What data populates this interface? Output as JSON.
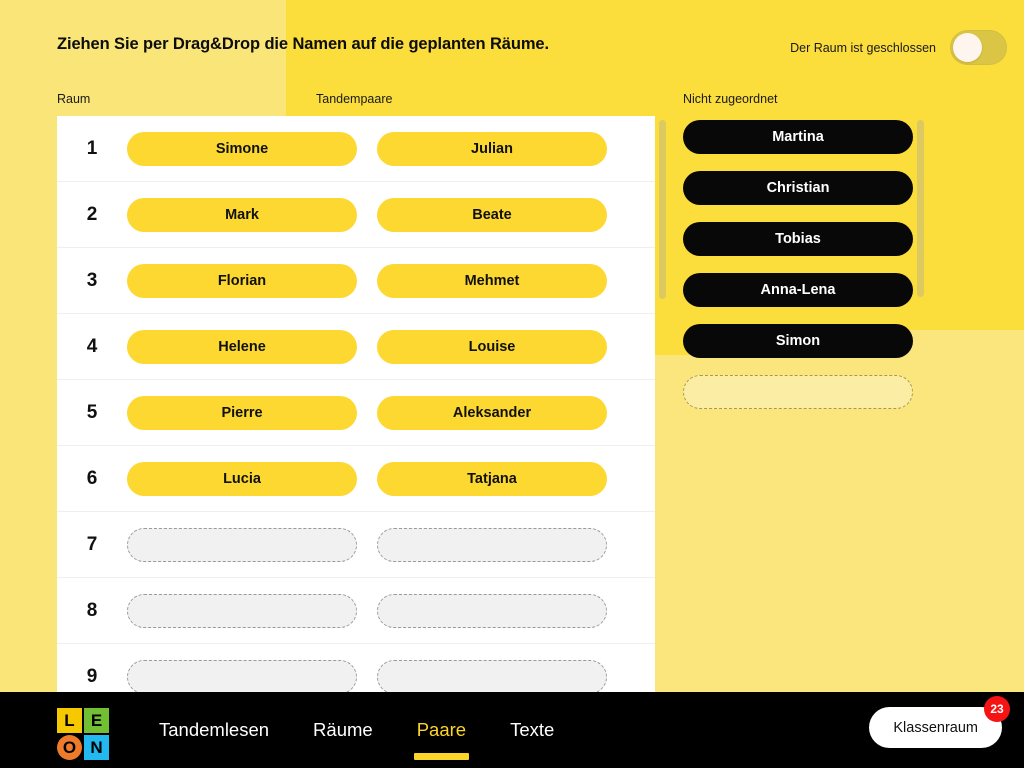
{
  "header": {
    "instruction": "Ziehen Sie per Drag&Drop die Namen auf die geplanten Räume.",
    "toggle_label": "Der Raum ist geschlossen",
    "toggle_state": "off"
  },
  "columns": {
    "room_label": "Raum",
    "pairs_label": "Tandempaare",
    "unassigned_label": "Nicht zugeordnet"
  },
  "rooms": [
    {
      "number": "1",
      "left": "Simone",
      "right": "Julian"
    },
    {
      "number": "2",
      "left": "Mark",
      "right": "Beate"
    },
    {
      "number": "3",
      "left": "Florian",
      "right": "Mehmet"
    },
    {
      "number": "4",
      "left": "Helene",
      "right": "Louise"
    },
    {
      "number": "5",
      "left": "Pierre",
      "right": "Aleksander"
    },
    {
      "number": "6",
      "left": "Lucia",
      "right": "Tatjana"
    },
    {
      "number": "7",
      "left": "",
      "right": ""
    },
    {
      "number": "8",
      "left": "",
      "right": ""
    },
    {
      "number": "9",
      "left": "",
      "right": ""
    }
  ],
  "unassigned": [
    "Martina",
    "Christian",
    "Tobias",
    "Anna-Lena",
    "Simon"
  ],
  "logo": {
    "l": "L",
    "e": "E",
    "o": "O",
    "n": "N"
  },
  "nav": {
    "items": [
      {
        "label": "Tandemlesen",
        "active": false
      },
      {
        "label": "Räume",
        "active": false
      },
      {
        "label": "Paare",
        "active": true
      },
      {
        "label": "Texte",
        "active": false
      }
    ]
  },
  "classroom": {
    "label": "Klassenraum",
    "badge": "23"
  },
  "colors": {
    "brand_yellow": "#FBDD3C",
    "pale_yellow": "#FAE578",
    "pill_yellow": "#FCD831",
    "black": "#080808",
    "badge_red": "#F51313",
    "scrollbar": "#DCC95F"
  }
}
